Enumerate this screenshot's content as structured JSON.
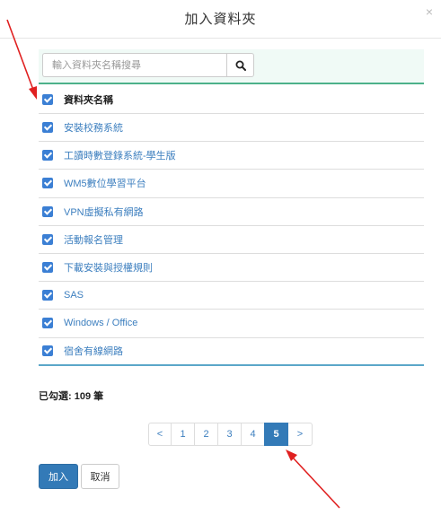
{
  "modal": {
    "title": "加入資料夾",
    "close_symbol": "×"
  },
  "search": {
    "placeholder": "輸入資料夾名稱搜尋",
    "value": "",
    "button_icon": "search-icon"
  },
  "table": {
    "header": "資料夾名稱",
    "header_checked": true,
    "rows": [
      {
        "label": "安裝校務系統",
        "checked": true
      },
      {
        "label": "工讀時數登錄系統-學生版",
        "checked": true
      },
      {
        "label": "WM5數位學習平台",
        "checked": true
      },
      {
        "label": "VPN虛擬私有網路",
        "checked": true
      },
      {
        "label": "活動報名管理",
        "checked": true
      },
      {
        "label": "下載安裝與授權規則",
        "checked": true
      },
      {
        "label": "SAS",
        "checked": true
      },
      {
        "label": "Windows / Office",
        "checked": true
      },
      {
        "label": "宿舍有線網路",
        "checked": true
      }
    ]
  },
  "selection": {
    "text": "已勾選: 109 筆"
  },
  "pagination": {
    "prev": "<",
    "pages": [
      "1",
      "2",
      "3",
      "4",
      "5"
    ],
    "active_page": "5",
    "next": ">"
  },
  "buttons": {
    "add_label": "加入",
    "cancel_label": "取消"
  },
  "colors": {
    "accent_blue": "#337ab7",
    "link_blue": "#3d7fbf",
    "search_bar_bg": "#f0faf6",
    "search_bar_border": "#4cb18a",
    "annotation_red": "#e02020"
  }
}
